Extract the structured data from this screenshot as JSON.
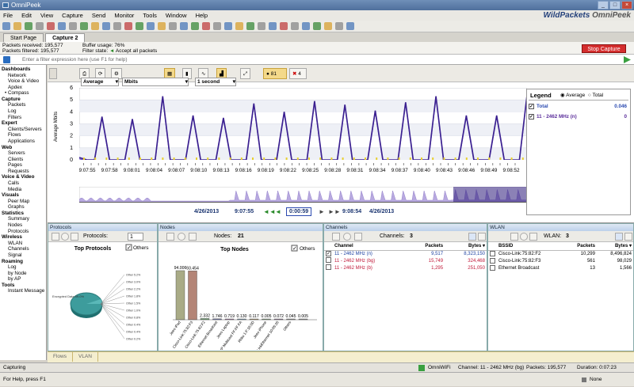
{
  "window": {
    "title": "OmniPeek",
    "brand_a": "WildPackets",
    "brand_b": "OmniPeek"
  },
  "menu": [
    "File",
    "Edit",
    "View",
    "Capture",
    "Send",
    "Monitor",
    "Tools",
    "Window",
    "Help"
  ],
  "tabs": [
    "Start Page",
    "Capture 2"
  ],
  "status": {
    "received_label": "Packets received:",
    "received": "195,577",
    "filtered_label": "Packets filtered:",
    "filtered": "195,577",
    "buffer_label": "Buffer usage:",
    "buffer": "76%",
    "filter_label": "Filter state:",
    "filter_state": "Accept all packets",
    "stop": "Stop Capture"
  },
  "filter": {
    "placeholder": "Enter a filter expression here (use F1 for help)"
  },
  "sidebar": [
    {
      "t": "h",
      "l": "Dashboards"
    },
    {
      "t": "i",
      "l": "Network"
    },
    {
      "t": "i",
      "l": "Voice & Video"
    },
    {
      "t": "i",
      "l": "Apdex"
    },
    {
      "t": "s",
      "l": "Compass"
    },
    {
      "t": "h",
      "l": "Capture"
    },
    {
      "t": "i",
      "l": "Packets"
    },
    {
      "t": "i",
      "l": "Log"
    },
    {
      "t": "i",
      "l": "Filters"
    },
    {
      "t": "h",
      "l": "Expert"
    },
    {
      "t": "i",
      "l": "Clients/Servers"
    },
    {
      "t": "i",
      "l": "Flows"
    },
    {
      "t": "i",
      "l": "Applications"
    },
    {
      "t": "h",
      "l": "Web"
    },
    {
      "t": "i",
      "l": "Servers"
    },
    {
      "t": "i",
      "l": "Clients"
    },
    {
      "t": "i",
      "l": "Pages"
    },
    {
      "t": "i",
      "l": "Requests"
    },
    {
      "t": "h",
      "l": "Voice & Video"
    },
    {
      "t": "i",
      "l": "Calls"
    },
    {
      "t": "i",
      "l": "Media"
    },
    {
      "t": "h",
      "l": "Visuals"
    },
    {
      "t": "i",
      "l": "Peer Map"
    },
    {
      "t": "i",
      "l": "Graphs"
    },
    {
      "t": "h",
      "l": "Statistics"
    },
    {
      "t": "i",
      "l": "Summary"
    },
    {
      "t": "i",
      "l": "Nodes"
    },
    {
      "t": "i",
      "l": "Protocols"
    },
    {
      "t": "h",
      "l": "Wireless"
    },
    {
      "t": "i",
      "l": "WLAN"
    },
    {
      "t": "i",
      "l": "Channels"
    },
    {
      "t": "i",
      "l": "Signal"
    },
    {
      "t": "h",
      "l": "Roaming"
    },
    {
      "t": "i",
      "l": "Log"
    },
    {
      "t": "i",
      "l": "by Node"
    },
    {
      "t": "i",
      "l": "by AP"
    },
    {
      "t": "h",
      "l": "Tools"
    },
    {
      "t": "i",
      "l": "Instant Message"
    }
  ],
  "charttb": {
    "mode": "Average",
    "unit": "Mbits",
    "interval": "1 second",
    "count_a": "81",
    "count_b": "4"
  },
  "chart_data": {
    "type": "line",
    "ylabel": "Average Mbits",
    "ylim": [
      0,
      6
    ],
    "yticks": [
      0,
      1,
      2,
      3,
      4,
      5,
      6
    ],
    "x": [
      "9:07:55",
      "9:07:58",
      "9:08:01",
      "9:08:04",
      "9:08:07",
      "9:08:10",
      "9:08:13",
      "9:08:16",
      "9:08:19",
      "9:08:22",
      "9:08:25",
      "9:08:28",
      "9:08:31",
      "9:08:34",
      "9:08:37",
      "9:08:40",
      "9:08:43",
      "9:08:46",
      "9:08:49",
      "9:08:52"
    ],
    "series": [
      {
        "name": "Total",
        "color": "#3a1f8f",
        "values": [
          0.2,
          0,
          0,
          3.6,
          0,
          0,
          0,
          3.4,
          0,
          0,
          0,
          5.3,
          0,
          0,
          0,
          3.7,
          0,
          0,
          0,
          3.5,
          0,
          0,
          0,
          4.7,
          0,
          0,
          0,
          4.0,
          0,
          0,
          0,
          4.9,
          0,
          0,
          0,
          4.6,
          0,
          0,
          0,
          4.1,
          0,
          0,
          0,
          4.8,
          0,
          0,
          0,
          5.3,
          0,
          0,
          0,
          3.7,
          0,
          0,
          0,
          3.7,
          0,
          0,
          0,
          5.4
        ]
      }
    ]
  },
  "nav": {
    "start_date": "4/26/2013",
    "start_time": "9:07:55",
    "span": "0:00:59",
    "end_time": "9:08:54",
    "end_date": "4/26/2013"
  },
  "legend": {
    "title": "Legend",
    "opt_avg": "Average",
    "opt_total": "Total",
    "rows": [
      {
        "name": "Total",
        "value": "0.046",
        "color": "#2b4ab0"
      },
      {
        "name": "11 - 2462 MHz (n)",
        "value": "0",
        "color": "#5a2d9a"
      }
    ]
  },
  "protocols": {
    "header": "Protocols",
    "label": "Protocols:",
    "count": "1",
    "title": "Top Protocols",
    "others": "Others",
    "pie_labels": [
      "Other 5.2%",
      "Other 3.0%",
      "Other 2.2%",
      "Other 1.8%",
      "Other 1.5%",
      "Other 1.0%",
      "Other 0.8%",
      "Other 0.4%",
      "Other 0.4%",
      "Other 0.2%"
    ],
    "left_label": "Encrypted Data 59.0%"
  },
  "nodes": {
    "header": "Nodes",
    "label": "Nodes:",
    "count": "21",
    "title": "Top Nodes",
    "others": "Others",
    "bars": [
      {
        "label": "Jeeo iPad",
        "value": "94.006",
        "v": 94.0,
        "color": "#a9ab86"
      },
      {
        "label": "Cisco-Link:75:82:F3",
        "value": "93.454",
        "v": 93.45,
        "color": "#b48577"
      },
      {
        "label": "Cisco-Link:75:82:F2",
        "value": "2.332",
        "v": 2.33,
        "color": "#6c9e6e"
      },
      {
        "label": "Ethernet Broadcast",
        "value": "1.746",
        "v": 1.75,
        "color": "#6d74a8"
      },
      {
        "label": "Jeeo Laptop",
        "value": "0.719",
        "v": 0.72,
        "color": "#aa7aaa"
      },
      {
        "label": "Mobil IP Multicast FF:FF:FA",
        "value": "0.130",
        "v": 0.13,
        "color": "#7aa0b8"
      },
      {
        "label": "Rhlio 1:F:16:0D",
        "value": "0.117",
        "v": 0.12,
        "color": "#b8a070"
      },
      {
        "label": "Jeeo iPhone",
        "value": "0.005",
        "v": 0.005,
        "color": "#8aaa88"
      },
      {
        "label": "LinkEthernet 10:05:26",
        "value": "0.072",
        "v": 0.07,
        "color": "#9a7aa0"
      },
      {
        "label": "Others",
        "value": "0.045",
        "v": 0.045,
        "color": "#999999"
      },
      {
        "label": "",
        "value": "0.005",
        "v": 0.005,
        "color": "#999999"
      }
    ]
  },
  "channels": {
    "header": "Channels",
    "label": "Channels:",
    "count": "3",
    "cols": [
      "Channel",
      "Packets",
      "Bytes"
    ],
    "rows": [
      {
        "checked": true,
        "name": "11 - 2462 MHz (n)",
        "packets": "9,517",
        "bytes": "8,323,150",
        "color": "#1a3fa0"
      },
      {
        "checked": false,
        "name": "11 - 2462 MHz (bg)",
        "packets": "15,749",
        "bytes": "324,468",
        "color": "#c01a3a"
      },
      {
        "checked": false,
        "name": "11 - 2462 MHz (b)",
        "packets": "1,295",
        "bytes": "251,050",
        "color": "#c01a3a"
      }
    ]
  },
  "wlan": {
    "header": "WLAN",
    "label": "WLAN:",
    "count": "3",
    "cols": [
      "BSSID",
      "Packets",
      "Bytes"
    ],
    "rows": [
      {
        "name": "Cisco-Link:75:82:F2",
        "packets": "10,299",
        "bytes": "8,496,824"
      },
      {
        "name": "Cisco-Link:75:82:F3",
        "packets": "561",
        "bytes": "98,029"
      },
      {
        "name": "Ethernet Broadcast",
        "packets": "13",
        "bytes": "1,566"
      }
    ]
  },
  "bottomtabs": [
    "Flows",
    "VLAN"
  ],
  "statusbar": {
    "left": "Capturing",
    "adapter": "OmniWiFi",
    "channel": "Channel: 11 - 2462 MHz (bg)",
    "packets": "Packets: 195,577",
    "duration": "Duration: 0:07:23",
    "help": "For Help, press F1",
    "none": "None"
  }
}
